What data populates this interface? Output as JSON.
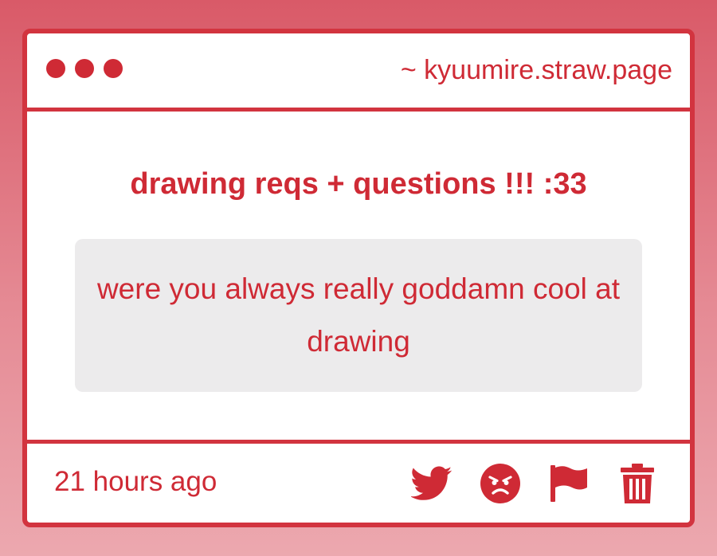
{
  "window": {
    "url": "~ kyuumire.straw.page"
  },
  "question": {
    "title": "drawing reqs + questions !!! :33",
    "text": "were you always really goddamn cool at drawing"
  },
  "footer": {
    "timestamp": "21 hours ago"
  },
  "icons": {
    "share": "twitter-icon",
    "react": "angry-face-icon",
    "report": "flag-icon",
    "delete": "trash-icon"
  },
  "colors": {
    "accent": "#cf2a35",
    "box_background": "#ecebec"
  }
}
